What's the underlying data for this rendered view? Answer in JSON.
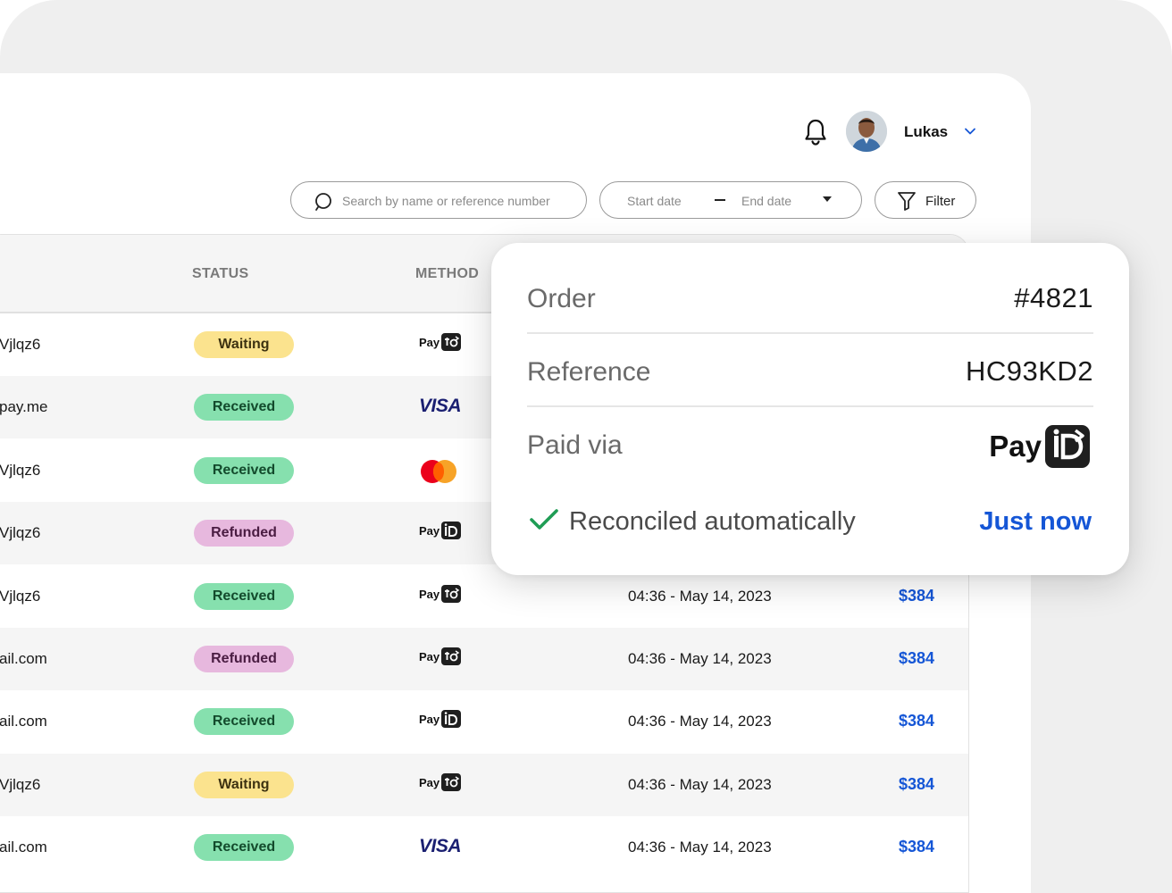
{
  "header": {
    "user_name": "Lukas",
    "icons": [
      "bell-icon",
      "avatar",
      "chevron-down-icon"
    ]
  },
  "toolbar": {
    "search_placeholder": "Search by name or reference number",
    "start_date_placeholder": "Start date",
    "end_date_placeholder": "End date",
    "filter_label": "Filter"
  },
  "table": {
    "headers": {
      "status": "STATUS",
      "method": "METHOD"
    },
    "rows": [
      {
        "name": "Vjlqz6",
        "status": "Waiting",
        "method": "payto",
        "date": "",
        "amount": ""
      },
      {
        "name": "pay.me",
        "status": "Received",
        "method": "visa",
        "date": "",
        "amount": ""
      },
      {
        "name": "Vjlqz6",
        "status": "Received",
        "method": "mastercard",
        "date": "",
        "amount": ""
      },
      {
        "name": "Vjlqz6",
        "status": "Refunded",
        "method": "payid",
        "date": "",
        "amount": ""
      },
      {
        "name": "Vjlqz6",
        "status": "Received",
        "method": "payto",
        "date": "04:36 - May 14, 2023",
        "amount": "$384"
      },
      {
        "name": "ail.com",
        "status": "Refunded",
        "method": "payto",
        "date": "04:36 - May 14, 2023",
        "amount": "$384"
      },
      {
        "name": "ail.com",
        "status": "Received",
        "method": "payid",
        "date": "04:36 - May 14, 2023",
        "amount": "$384"
      },
      {
        "name": "Vjlqz6",
        "status": "Waiting",
        "method": "payto",
        "date": "04:36 - May 14, 2023",
        "amount": "$384"
      },
      {
        "name": "ail.com",
        "status": "Received",
        "method": "visa",
        "date": "04:36 - May 14, 2023",
        "amount": "$384"
      }
    ]
  },
  "popover": {
    "order_label": "Order",
    "order_value": "#4821",
    "reference_label": "Reference",
    "reference_value": "HC93KD2",
    "paid_via_label": "Paid via",
    "paid_via_logo_text": "Pay",
    "reconciled_text": "Reconciled automatically",
    "reconciled_time": "Just now"
  },
  "method_text": {
    "pay": "Pay",
    "visa": "VISA"
  },
  "colors": {
    "accent_blue": "#1556d6",
    "waiting": "#fbe38e",
    "received": "#86e0ae",
    "refunded": "#e7b8de",
    "check_green": "#1f9d55"
  }
}
